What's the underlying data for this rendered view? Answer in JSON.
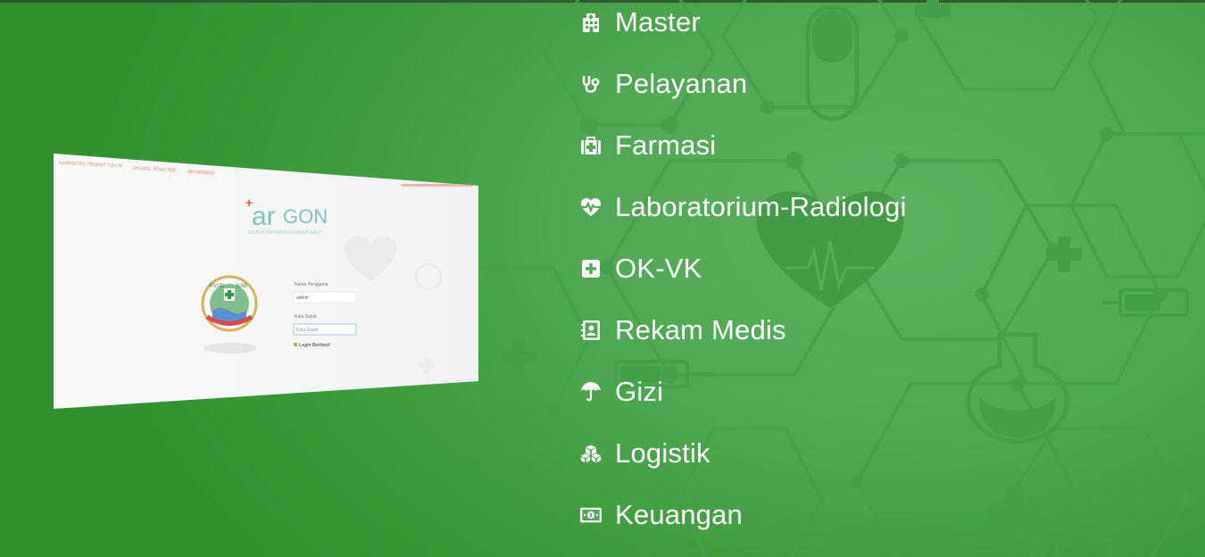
{
  "colors": {
    "background_start": "#2f922f",
    "background_end": "#5cb15f",
    "topbar": "#2f5a33",
    "menu_text": "#ffffff",
    "decor_line": "#3f9a43"
  },
  "preview": {
    "nav_links": [
      "KAPASITAS TEMPAT TIDUR",
      "JADWAL PRAKTEK",
      "INFORMASI"
    ],
    "brand_mark": "+",
    "brand_name_lower": "ar",
    "brand_name_upper": "GON",
    "brand_tagline": "SISTEM INFORMASI RUMAH SAKIT",
    "username_label": "Nama Pengguna",
    "username_value": "admin",
    "password_label": "Kata Sandi",
    "password_placeholder": "Kata Sandi",
    "login_button": "Login Berhasil",
    "seal_top_left": "RSUD",
    "seal_top_right": "KAB"
  },
  "menu": {
    "items": [
      {
        "label": "Master",
        "icon": "hospital-icon"
      },
      {
        "label": "Pelayanan",
        "icon": "stethoscope-icon"
      },
      {
        "label": "Farmasi",
        "icon": "medkit-icon"
      },
      {
        "label": "Laboratorium-Radiologi",
        "icon": "heartbeat-icon"
      },
      {
        "label": "OK-VK",
        "icon": "plus-square-icon"
      },
      {
        "label": "Rekam Medis",
        "icon": "address-book-icon"
      },
      {
        "label": "Gizi",
        "icon": "umbrella-icon"
      },
      {
        "label": "Logistik",
        "icon": "cubes-icon"
      },
      {
        "label": "Keuangan",
        "icon": "money-icon"
      }
    ]
  }
}
